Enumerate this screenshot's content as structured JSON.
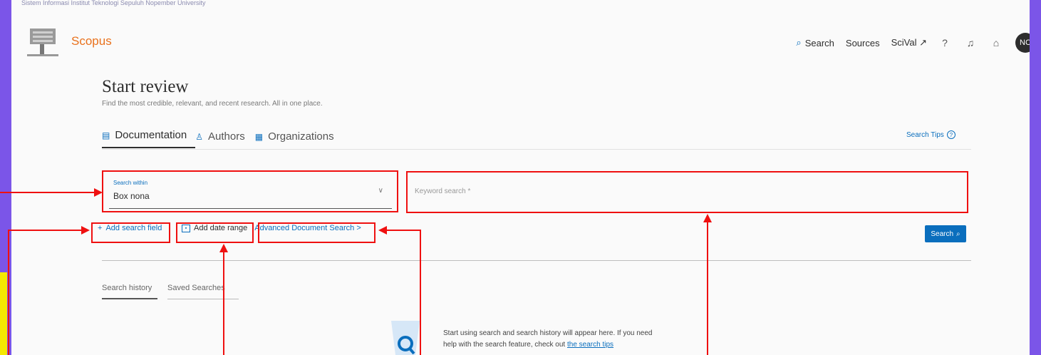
{
  "header": {
    "institution_line": "Sistem Informasi Institut Teknologi Sepuluh Nopember University",
    "brand": "Scopus",
    "nav": {
      "search": "Search",
      "sources": "Sources",
      "scival": "SciVal ↗",
      "avatar_initials": "NC"
    }
  },
  "page": {
    "title": "Start review",
    "subtitle": "Find the most credible, relevant, and recent research. All in one place.",
    "tabs": [
      "Documentation",
      "Authors",
      "Organizations"
    ],
    "search_tips": "Search Tips"
  },
  "search_form": {
    "search_within_label": "Search within",
    "search_within_value": "Box nona",
    "keyword_placeholder": "Keyword search *",
    "add_search_field": "Add search field",
    "add_date_range": "Add date range",
    "advanced_search": "Advanced Document Search >",
    "search_button": "Search"
  },
  "history": {
    "tabs": [
      "Search history",
      "Saved Searches"
    ],
    "empty_text_1": "Start using search and search history will appear here. If you need",
    "empty_text_2": "help with the search feature, check out ",
    "empty_link": "the search tips"
  },
  "colors": {
    "accent": "#0a6ebd",
    "brand": "#e9711c",
    "highlight": "#ef1010",
    "background": "#7b55e8"
  }
}
